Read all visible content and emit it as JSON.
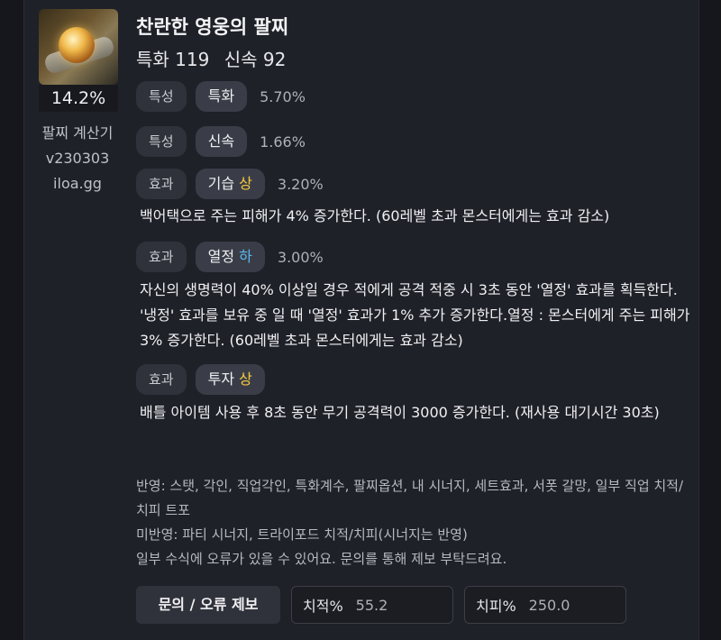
{
  "item": {
    "percent": "14.2%",
    "side_lines": [
      "팔찌 계산기",
      "v230303",
      "iloa.gg"
    ],
    "title": "찬란한 영웅의 팔찌",
    "stats": [
      "특화 119",
      "신속 92"
    ]
  },
  "rows": [
    {
      "kind": "특성",
      "name": "특화",
      "grade": "",
      "value": "5.70%"
    },
    {
      "kind": "특성",
      "name": "신속",
      "grade": "",
      "value": "1.66%"
    },
    {
      "kind": "효과",
      "name": "기습",
      "grade": "상",
      "value": "3.20%",
      "desc": "백어택으로 주는 피해가 4% 증가한다. (60레벨 초과 몬스터에게는 효과 감소)"
    },
    {
      "kind": "효과",
      "name": "열정",
      "grade": "하",
      "value": "3.00%",
      "desc": "자신의 생명력이 40% 이상일 경우 적에게 공격 적중 시 3초 동안 '열정' 효과를 획득한다. '냉정' 효과를 보유 중 일 때 '열정' 효과가 1% 추가 증가한다.열정 : 몬스터에게 주는 피해가 3% 증가한다. (60레벨 초과 몬스터에게는 효과 감소)"
    },
    {
      "kind": "효과",
      "name": "투자",
      "grade": "상",
      "value": "",
      "desc": "배틀 아이템 사용 후 8초 동안 무기 공격력이 3000 증가한다. (재사용 대기시간 30초)"
    }
  ],
  "notes": {
    "applied": "반영: 스탯, 각인, 직업각인, 특화계수, 팔찌옵션, 내 시너지, 세트효과, 서폿 갈망, 일부 직업 치적/치피 트포",
    "not_applied": "미반영: 파티 시너지, 트라이포드 치적/치피(시너지는 반영)",
    "warning": "일부 수식에 오류가 있을 수 있어요. 문의를 통해 제보 부탁드려요."
  },
  "footer": {
    "report_button": "문의 / 오류 제보",
    "crit_rate_label": "치적%",
    "crit_rate_value": "55.2",
    "crit_dmg_label": "치피%",
    "crit_dmg_value": "250.0"
  },
  "colors": {
    "grade_high": "#f5c842",
    "grade_low": "#5ab8f0"
  }
}
